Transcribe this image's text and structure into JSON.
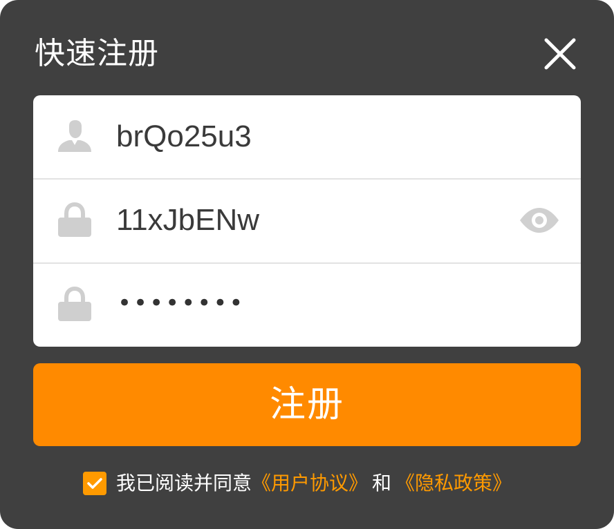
{
  "dialog": {
    "title": "快速注册",
    "close_icon": "close-icon"
  },
  "form": {
    "username": {
      "icon": "user-icon",
      "value": "brQo25u3"
    },
    "password": {
      "icon": "lock-icon",
      "value": "11xJbENw",
      "toggle_icon": "eye-icon"
    },
    "confirm_password": {
      "icon": "lock-icon",
      "masked_value": "••••••••"
    }
  },
  "submit": {
    "label": "注册"
  },
  "agreement": {
    "checked": true,
    "text": "我已阅读并同意",
    "user_agreement_link": "《用户协议》",
    "and_text": "和",
    "privacy_policy_link": "《隐私政策》"
  },
  "colors": {
    "background": "#404040",
    "accent": "#ff8a00",
    "card": "#ffffff",
    "icon_gray": "#cfcfcf"
  }
}
